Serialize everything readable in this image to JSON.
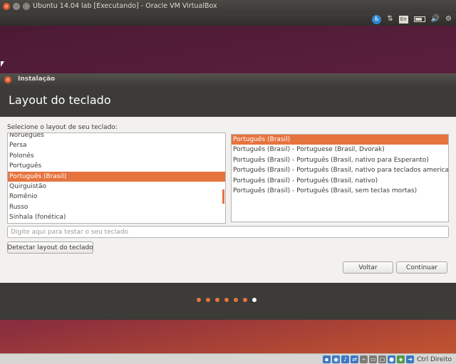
{
  "vbox": {
    "window_title": "Ubuntu 14.04 lab [Executando] - Oracle VM VirtualBox",
    "status_text": "Ctrl Direito"
  },
  "panel": {
    "language_badge": "En",
    "icons": [
      "accessibility-icon",
      "network-icon",
      "keyboard-language-icon",
      "battery-icon",
      "volume-icon",
      "settings-gear-icon"
    ]
  },
  "installer": {
    "window_title": "Instalação",
    "heading": "Layout do teclado",
    "prompt": "Selecione o layout de seu teclado:",
    "layouts": [
      "Norueguês",
      "Persa",
      "Polonês",
      "Português",
      "Português (Brasil)",
      "Quirguistão",
      "Romênio",
      "Russo",
      "Sinhala (fonética)"
    ],
    "selected_layout": "Português (Brasil)",
    "variants": [
      "Português (Brasil)",
      "Português (Brasil) - Portuguese (Brasil, Dvorak)",
      "Português (Brasil) - Português (Brasil, nativo para Esperanto)",
      "Português (Brasil) - Português (Brasil, nativo para teclados americanos)",
      "Português (Brasil) - Português (Brasil, nativo)",
      "Português (Brasil) - Português (Brasil, sem teclas mortas)"
    ],
    "selected_variant": "Português (Brasil)",
    "test_placeholder": "Digite aqui para testar o seu teclado",
    "detect_button": "Detectar layout do teclado",
    "back_button": "Voltar",
    "continue_button": "Continuar",
    "progress_step": 7,
    "progress_total": 7,
    "accent_color": "#e6743f"
  }
}
